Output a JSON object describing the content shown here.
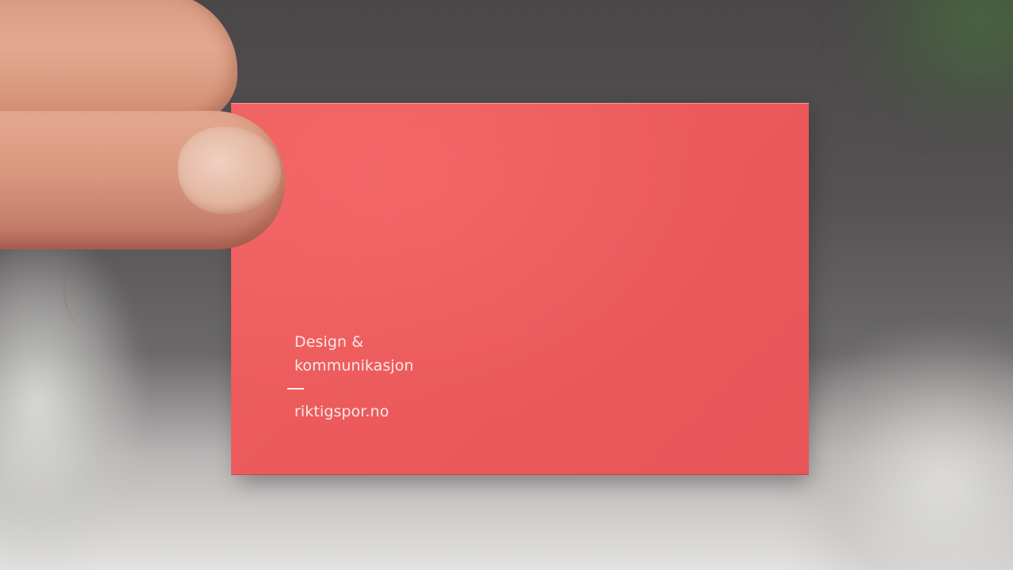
{
  "image": {
    "background_colors": [
      "#4a4748",
      "#6b6969",
      "#e3e2e0"
    ],
    "card_color": "#ec5a5b",
    "text_color": "#fbe9e8",
    "skin_color": "#d9987e"
  },
  "card": {
    "line1": "Design &",
    "line2": "kommunikasjon",
    "divider": "—",
    "website": "riktigspor.no"
  }
}
